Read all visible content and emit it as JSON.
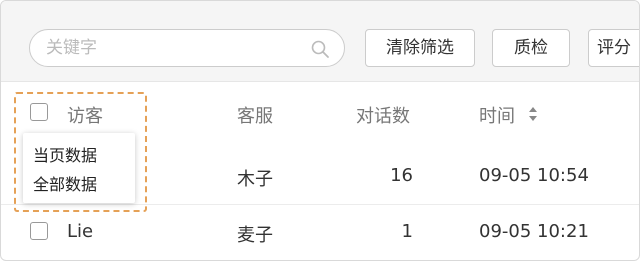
{
  "toolbar": {
    "search_placeholder": "关键字",
    "clear_filters_label": "清除筛选",
    "quality_check_label": "质检",
    "score_label": "评分"
  },
  "table": {
    "columns": {
      "visitor": "访客",
      "agent": "客服",
      "messages": "对话数",
      "time": "时间"
    },
    "rows": [
      {
        "visitor": "",
        "agent": "木子",
        "messages": "16",
        "time": "09-05 10:54"
      },
      {
        "visitor": "Lie",
        "agent": "麦子",
        "messages": "1",
        "time": "09-05 10:21"
      }
    ]
  },
  "select_menu": {
    "items": [
      "当页数据",
      "全部数据"
    ]
  },
  "colors": {
    "highlight_border": "#e5a157",
    "toolbar_bg": "#f5f5f5"
  }
}
